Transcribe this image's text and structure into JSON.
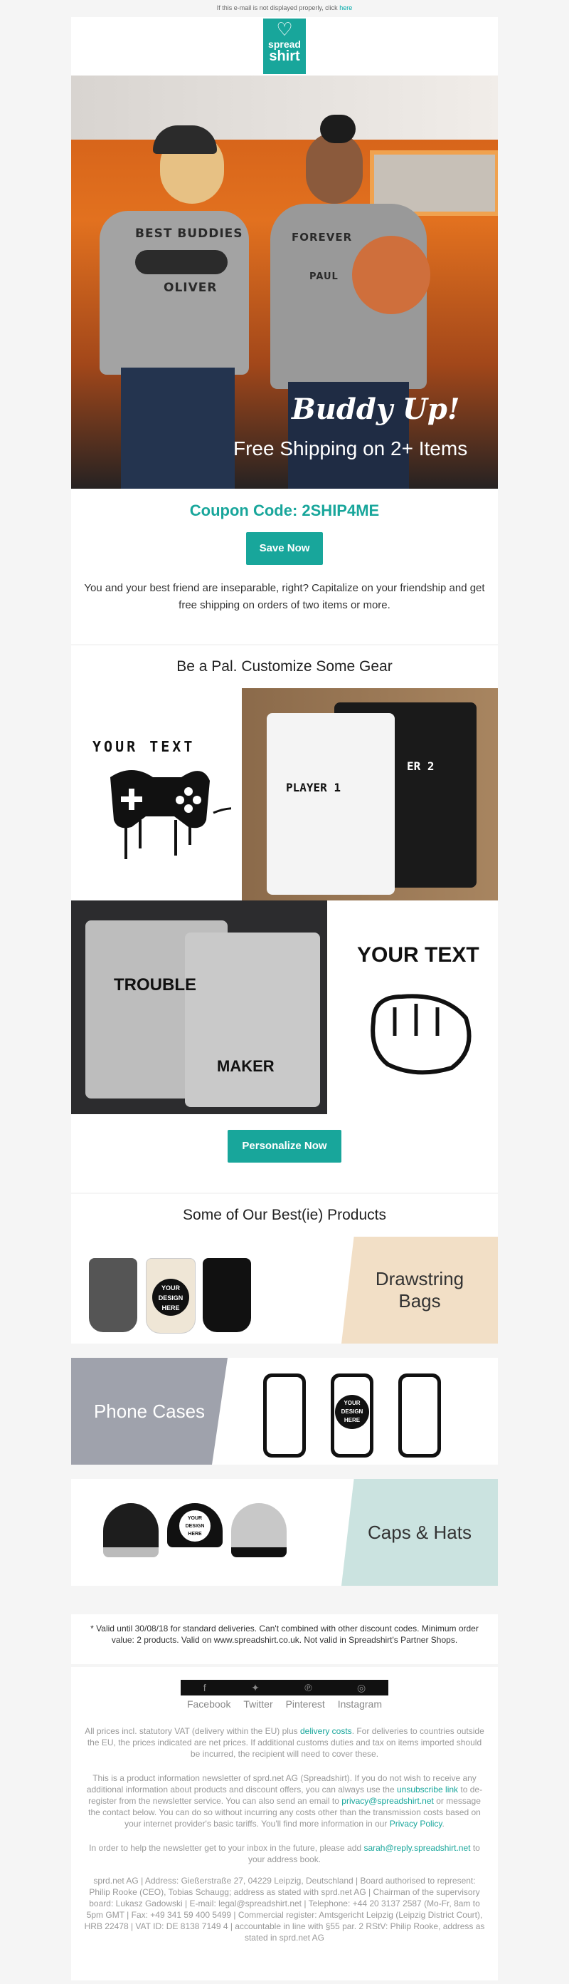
{
  "top_note": {
    "text": "If this e-mail is not displayed properly, click",
    "link": "here"
  },
  "logo": {
    "line1": "spread",
    "line2": "shirt"
  },
  "hero": {
    "title": "Buddy Up!",
    "subtitle": "Free Shipping on 2+ Items",
    "shirt1_top": "BEST BUDDIES",
    "shirt1_bottom": "OLIVER",
    "shirt2_top": "FOREVER",
    "shirt2_bottom": "PAUL"
  },
  "coupon": {
    "label": "Coupon Code: 2SHIP4ME",
    "button": "Save Now",
    "intro": "You and your best friend are inseparable, right? Capitalize on your friendship and get free shipping on orders of two items or more."
  },
  "gear": {
    "title": "Be a Pal. Customize Some Gear",
    "text1": "YOUR TEXT",
    "player1": "PLAYER 1",
    "player2": "ER 2",
    "trouble": "TROUBLE",
    "maker": "MAKER",
    "text2": "YOUR TEXT",
    "button": "Personalize Now"
  },
  "products": {
    "title": "Some of Our Best(ie) Products",
    "bags": "Drawstring Bags",
    "phones": "Phone Cases",
    "caps": "Caps & Hats",
    "design_line1": "YOUR",
    "design_line2": "DESIGN",
    "design_line3": "HERE"
  },
  "disclaimer": "* Valid until 30/08/18 for standard deliveries. Can't combined with other discount codes. Minimum order value: 2 products. Valid on www.spreadshirt.co.uk. Not valid in Spreadshirt's Partner Shops.",
  "social": {
    "labels": [
      "Facebook",
      "Twitter",
      "Pinterest",
      "Instagram"
    ]
  },
  "footer": {
    "vat": "All prices incl. statutory VAT (delivery within the EU) plus",
    "vat_link": "delivery costs",
    "vat_rest": ". For deliveries to countries outside the EU, the prices indicated are net prices. If additional customs duties and tax on items imported should be incurred, the recipient will need to cover these.",
    "info_a": "This is a product information newsletter of sprd.net AG (Spreadshirt). If you do not wish to receive any additional information about products and discount offers, you can always use the",
    "unsubscribe_link": "unsubscribe link",
    "info_b": "to de-register from the newsletter service. You can also send an email to",
    "privacy_email": "privacy@spreadshirt.net",
    "info_c": "or message the contact below. You can do so without incurring any costs other than the transmission costs based on your internet provider's basic tariffs. You'll find more information in our",
    "privacy_link": "Privacy Policy",
    "inbox_a": "In order to help the newsletter get to your inbox in the future, please add",
    "reply_email": "sarah@reply.spreadshirt.net",
    "inbox_b": "to your address book.",
    "company": "sprd.net AG | Address: Gießerstraße 27, 04229 Leipzig, Deutschland | Board authorised to represent: Philip Rooke (CEO), Tobias Schaugg; address as stated with sprd.net AG | Chairman of the supervisory board: Lukasz Gadowski | E-mail: legal@spreadshirt.net | Telephone: +44 20 3137 2587 (Mo-Fr, 8am to 5pm GMT | Fax: +49 341 59 400 5499 | Commercial register: Amtsgericht Leipzig (Leipzig District Court), HRB 22478 | VAT ID: DE 8138 7149 4 | accountable in line with §55 par. 2 RStV: Philip Rooke, address as stated in sprd.net AG"
  },
  "colors": {
    "brand": "#18a69b"
  }
}
